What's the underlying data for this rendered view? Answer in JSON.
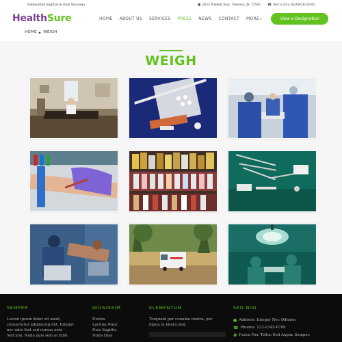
{
  "topbar": {
    "left": "Elementum Sagittis & Duis Sociosqu",
    "address": "2653 Polikeli hwy., Vonovia, JK 73582",
    "phone": "Nec's orca (624)428-26-85"
  },
  "logo": {
    "part1": "Health",
    "part2": "Sure"
  },
  "nav": {
    "items": [
      "HOME",
      "ABOUT US",
      "SERVICES",
      "PRESS",
      "NEWS",
      "CONTACT"
    ],
    "more": "MORE",
    "active_index": 3,
    "cta": "View a Designation"
  },
  "breadcrumb": {
    "home": "HOME",
    "current": "WEIGH"
  },
  "page": {
    "title": "WEIGH"
  },
  "gallery": {
    "images": [
      "doctor-office",
      "medical-tools",
      "surgeons-operating",
      "blood-draw",
      "medicine-bottles",
      "surgical-instruments",
      "patient-surgery",
      "ambulance-palms",
      "operating-room"
    ]
  },
  "footer": {
    "col1": {
      "title": "SEMPER",
      "text": [
        "Lorem ipsum dolor sit amet,",
        "consectetur adipiscing elit. Integer",
        "nec odio Sed sed cursus ante",
        "Sed nisi. Nulla quis sem at nibh"
      ]
    },
    "col2": {
      "title": "DIGNISSIM",
      "links": [
        "Nostra",
        "Lacinia Nunc",
        "Duis Sagittis",
        "Nulla Quis"
      ]
    },
    "col3": {
      "title": "ELEMENTUM",
      "text": [
        "Torquent per conubia nostra, per",
        "ligula in libero.Sed."
      ]
    },
    "col4": {
      "title": "SED NISI",
      "address": "Address: Integer Nec Odionec",
      "phone": "Phones: 123-2345-6789",
      "email": "Fusce Nec Tellus Sed Augue Semper."
    }
  },
  "colors": {
    "brand_green": "#62c320",
    "brand_purple": "#7b3f98",
    "footer_bg": "#0c0c0c"
  }
}
